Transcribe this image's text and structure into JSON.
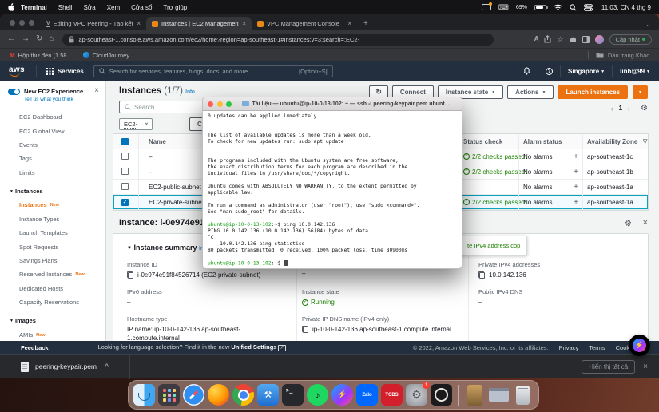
{
  "menubar": {
    "menus": [
      "Terminal",
      "Shell",
      "Sửa",
      "Xem",
      "Cửa sổ",
      "Trợ giúp"
    ],
    "battery": "69%",
    "clock": "11:03, CN 4 thg 9"
  },
  "browser": {
    "tabs": [
      {
        "title": "Editing VPC Peering - Tạo kết n",
        "icon": "v",
        "active": false
      },
      {
        "title": "Instances | EC2 Management C",
        "icon": "aws",
        "active": true
      },
      {
        "title": "VPC Management Console",
        "icon": "aws",
        "active": false
      }
    ],
    "url": "ap-southeast-1.console.aws.amazon.com/ec2/home?region=ap-southeast-1#Instances:v=3;search=:EC2-",
    "update_button": "Cập nhật",
    "bookmarks": [
      {
        "icon": "gmail",
        "label": "Hộp thư đến (1.58..."
      },
      {
        "icon": "cloudjourney",
        "label": "CloudJourney"
      }
    ],
    "other_bookmarks": "Dấu trang Khác"
  },
  "aws_nav": {
    "services": "Services",
    "search_placeholder": "Search for services, features, blogs, docs, and more",
    "shortcut": "[Option+S]",
    "region": "Singapore",
    "account": "linh@99"
  },
  "sidebar": {
    "new_experience": "New EC2 Experience",
    "tell_us": "Tell us what you think",
    "items": [
      {
        "label": "EC2 Dashboard"
      },
      {
        "label": "EC2 Global View"
      },
      {
        "label": "Events"
      },
      {
        "label": "Tags"
      },
      {
        "label": "Limits"
      },
      {
        "label": "Instances",
        "section": true
      },
      {
        "label": "Instances",
        "selected": true,
        "badge": "New"
      },
      {
        "label": "Instance Types"
      },
      {
        "label": "Launch Templates"
      },
      {
        "label": "Spot Requests"
      },
      {
        "label": "Savings Plans"
      },
      {
        "label": "Reserved Instances",
        "badge": "New"
      },
      {
        "label": "Dedicated Hosts"
      },
      {
        "label": "Capacity Reservations"
      },
      {
        "label": "Images",
        "section": true
      },
      {
        "label": "AMIs",
        "badge": "New"
      }
    ]
  },
  "instances": {
    "title": "Instances",
    "count": "(1/7)",
    "info": "Info",
    "buttons": {
      "connect": "Connect",
      "instance_state": "Instance state",
      "actions": "Actions",
      "launch": "Launch instances"
    },
    "search_placeholder": "Search",
    "filter_chip": "EC2-",
    "clear_filters": "Clear f",
    "page": "1",
    "table": {
      "headers": [
        "Name",
        "Status check",
        "Alarm status",
        "Availability Zone"
      ],
      "rows": [
        {
          "name": "–",
          "checked": false,
          "status": "2/2 checks passed",
          "alarm": "No alarms",
          "az": "ap-southeast-1c"
        },
        {
          "name": "–",
          "checked": false,
          "status": "2/2 checks passed",
          "alarm": "No alarms",
          "az": "ap-southeast-1b"
        },
        {
          "name": "EC2-public-subnet",
          "checked": false,
          "status": "",
          "alarm": "No alarms",
          "az": "ap-southeast-1a"
        },
        {
          "name": "EC2-private-subnet",
          "checked": true,
          "selected": true,
          "status": "2/2 checks passed",
          "alarm": "No alarms",
          "az": "ap-southeast-1a"
        }
      ]
    }
  },
  "details": {
    "header": "Instance: i-0e974e91f",
    "copied_tooltip": "te IPv4 address cop",
    "summary_title": "Instance summary",
    "summary_info": "Inf",
    "instance_id_label": "Instance ID",
    "instance_id": "i-0e974e91f84526714 (EC2-private-subnet)",
    "public_ipv4_value": "–",
    "private_ipv4_label": "Private IPv4 addresses",
    "private_ipv4": "10.0.142.136",
    "ipv6_label": "IPv6 address",
    "ipv6": "–",
    "state_label": "Instance state",
    "state": "Running",
    "public_dns_label": "Public IPv4 DNS",
    "public_dns": "–",
    "hostname_label": "Hostname type",
    "hostname_line1": "IP name: ip-10-0-142-136.ap-southeast-",
    "hostname_line2": "1.compute.internal",
    "private_dns_label": "Private IP DNS name (IPv4 only)",
    "private_dns": "ip-10-0-142-136.ap-southeast-1.compute.internal"
  },
  "terminal": {
    "title": "Tài liệu — ubuntu@ip-10-0-13-102: ~ — ssh -i peering-keypair.pem ubunt...",
    "prompt": "ubuntu@ip-10-0-13-102",
    "prompt_suffix": ":~$ ",
    "lines": [
      {
        "t": "0 updates can be applied immediately."
      },
      {
        "t": ""
      },
      {
        "t": ""
      },
      {
        "t": "The list of available updates is more than a week old."
      },
      {
        "t": "To check for new updates run: sudo apt update"
      },
      {
        "t": ""
      },
      {
        "t": ""
      },
      {
        "t": "The programs included with the Ubuntu system are free software;"
      },
      {
        "t": "the exact distribution terms for each program are described in the"
      },
      {
        "t": "individual files in /usr/share/doc/*/copyright."
      },
      {
        "t": ""
      },
      {
        "t": "Ubuntu comes with ABSOLUTELY NO WARRAN TY, to the extent permitted by"
      },
      {
        "t": "applicable law."
      },
      {
        "t": ""
      },
      {
        "t": "To run a command as administrator (user \"root\"), use \"sudo <command>\"."
      },
      {
        "t": "See \"man sudo_root\" for details."
      },
      {
        "t": ""
      },
      {
        "p": true,
        "t": "ping 10.0.142.136"
      },
      {
        "t": "PING 10.0.142.136 (10.0.142.136) 56(84) bytes of data."
      },
      {
        "t": "^C"
      },
      {
        "t": "--- 10.0.142.136 ping statistics ---"
      },
      {
        "t": "80 packets transmitted, 0 received, 100% packet loss, time 80900ms"
      },
      {
        "t": ""
      },
      {
        "p": true,
        "t": "",
        "cursor": true
      }
    ]
  },
  "footer": {
    "feedback": "Feedback",
    "language_text": "Looking for language selection? Find it in the new ",
    "language_link": "Unified Settings",
    "copyright": "© 2022, Amazon Web Services, Inc. or its affiliates.",
    "links": [
      "Privacy",
      "Terms",
      "Cookie pref"
    ]
  },
  "downloads": {
    "filename": "peering-keypair.pem",
    "show_all": "Hiển thị tất cả"
  },
  "dock": {
    "apps": [
      "finder",
      "launchpad",
      "safari",
      "firefox",
      "chrome",
      "xcode",
      "terminal",
      "spotify",
      "messenger",
      "zalo",
      "tcbs",
      "settings",
      "record"
    ],
    "labels": {
      "zalo": "Zalo",
      "tcbs": "TCBS"
    },
    "badges": {
      "settings": "1"
    },
    "shortcuts": [
      "downloads",
      "window",
      "trash"
    ]
  },
  "colors": {
    "aws_orange": "#ec7211",
    "aws_nav_bg": "#232f3e",
    "link_blue": "#0073bb",
    "status_green": "#1d8102",
    "selected_row_bg": "#f1faff"
  }
}
